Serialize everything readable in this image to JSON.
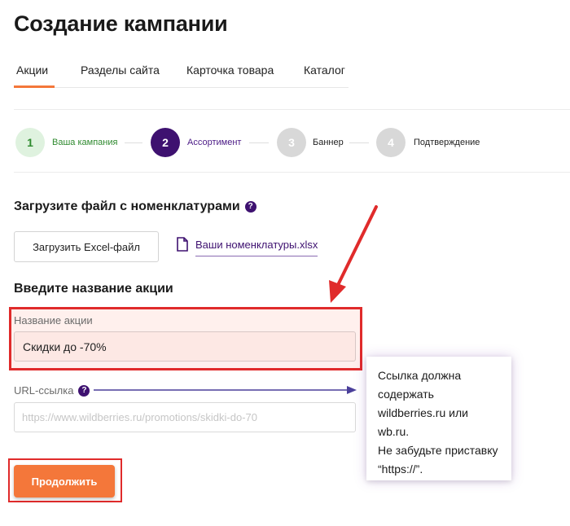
{
  "page_title": "Создание кампании",
  "tabs": [
    "Акции",
    "Разделы сайта",
    "Карточка товара",
    "Каталог"
  ],
  "steps": [
    {
      "number": "1",
      "label": "Ваша кампания"
    },
    {
      "number": "2",
      "label": "Ассортимент"
    },
    {
      "number": "3",
      "label": "Баннер"
    },
    {
      "number": "4",
      "label": "Подтверждение"
    }
  ],
  "upload_section": {
    "title": "Загрузите файл с номенклатурами",
    "help_icon": "?",
    "button_label": "Загрузить Excel-файл",
    "file_link": "Ваши номенклатуры.xlsx"
  },
  "name_section": {
    "title": "Введите название акции",
    "name_label": "Название акции",
    "name_value": "Скидки до -70%",
    "url_label": "URL-ссылка",
    "url_placeholder": "https://www.wildberries.ru/promotions/skidki-do-70"
  },
  "continue_button": "Продолжить",
  "tooltip": {
    "lines": [
      "Ссылка должна",
      "содержать",
      "wildberries.ru или",
      "wb.ru.",
      "Не забудьте приставку",
      "“https://”."
    ]
  },
  "colors": {
    "accent_orange": "#f4773a",
    "step_active": "#3e1170",
    "step_done_bg": "#dff2df",
    "step_done_text": "#2f8a2f",
    "highlight_red": "#e02b2b",
    "arrow_purple": "#4a3f9a"
  }
}
